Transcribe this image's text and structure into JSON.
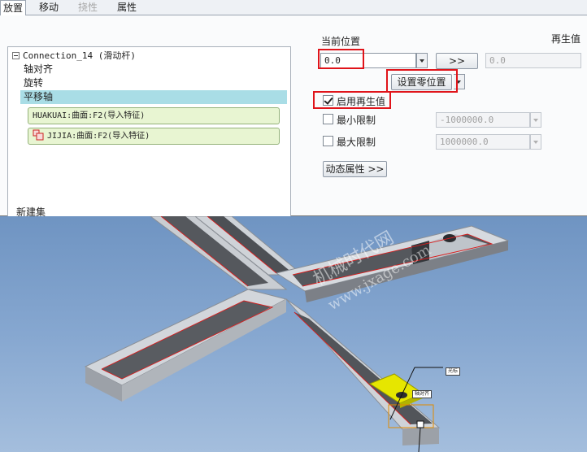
{
  "tabs": [
    {
      "label": "放置",
      "active": true
    },
    {
      "label": "移动",
      "active": false
    },
    {
      "label": "挠性",
      "disabled": true
    },
    {
      "label": "属性",
      "active": false
    }
  ],
  "tree": {
    "title": "Connection_14 (滑动杆)",
    "items": [
      "轴对齐",
      "旋转",
      "平移轴"
    ],
    "refs": [
      "HUAKUAI:曲面:F2(导入特征)",
      "JIJIA:曲面:F2(导入特征)"
    ],
    "new_set": "新建集"
  },
  "current_position": {
    "label": "当前位置",
    "value": "0.0",
    "copy_button": ">>",
    "set_zero_button": "设置零位置"
  },
  "regen": {
    "label": "再生值",
    "value": "0.0",
    "enable_label": "启用再生值",
    "enabled": true
  },
  "limits": {
    "min_label": "最小限制",
    "min_value": "-1000000.0",
    "max_label": "最大限制",
    "max_value": "1000000.0"
  },
  "dynamic_button": "动态属性 >>",
  "viewport": {
    "watermark": "机械时代网",
    "watermark_url": "www.jxage.com",
    "tags": [
      "光标",
      "轴对齐"
    ]
  },
  "colors": {
    "highlight": "#e0141a",
    "selection": "#a9dde6",
    "ref_fill": "#e8f5d2",
    "viewport_bg": "#86a7d0",
    "part_yellow": "#e6e600"
  }
}
